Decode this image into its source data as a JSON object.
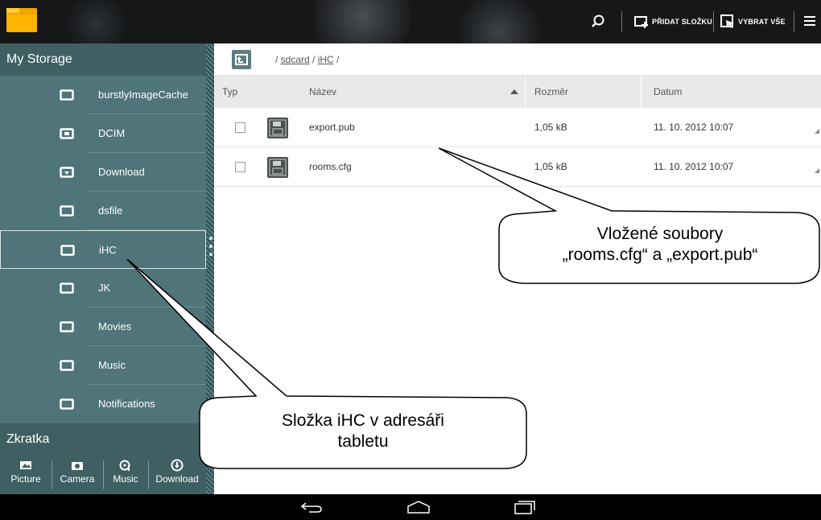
{
  "actionbar": {
    "search_icon": "search-icon",
    "add_folder_label": "PŘIDAT SLOŽKU",
    "select_all_label": "VYBRAT VŠE",
    "menu_icon": "overflow-menu-icon"
  },
  "sidebar": {
    "storage_header": "My Storage",
    "items": [
      {
        "label": "burstlyImageCache",
        "icon": "folder-icon"
      },
      {
        "label": "DCIM",
        "icon": "folder-image-icon"
      },
      {
        "label": "Download",
        "icon": "folder-download-icon"
      },
      {
        "label": "dsfile",
        "icon": "folder-icon"
      },
      {
        "label": "iHC",
        "icon": "folder-icon"
      },
      {
        "label": "JK",
        "icon": "folder-icon"
      },
      {
        "label": "Movies",
        "icon": "folder-icon"
      },
      {
        "label": "Music",
        "icon": "folder-icon"
      },
      {
        "label": "Notifications",
        "icon": "folder-icon"
      }
    ],
    "shortcut_header": "Zkratka",
    "shortcuts": [
      {
        "label": "Picture",
        "icon": "picture-icon"
      },
      {
        "label": "Camera",
        "icon": "camera-icon"
      },
      {
        "label": "Music",
        "icon": "music-icon"
      },
      {
        "label": "Download",
        "icon": "download-icon"
      }
    ]
  },
  "pathbar": {
    "prefix": "/ ",
    "seg1": "sdcard",
    "sep": " / ",
    "seg2": "iHC",
    "suffix": " /"
  },
  "table": {
    "headers": {
      "type": "Typ",
      "name": "Název",
      "size": "Rozměr",
      "date": "Datum"
    },
    "rows": [
      {
        "name": "export.pub",
        "size": "1,05 kB",
        "date": "11. 10. 2012 10:07"
      },
      {
        "name": "rooms.cfg",
        "size": "1,05 kB",
        "date": "11. 10. 2012 10:07"
      }
    ]
  },
  "callouts": {
    "files_line1": "Vložené soubory",
    "files_line2": "„rooms.cfg“ a „export.pub“",
    "folder_line1": "Složka iHC v  adresáři",
    "folder_line2": "tabletu"
  },
  "colors": {
    "sidebar": "#4f7479",
    "sidebar_header": "#3f5f63",
    "actionbar": "#161718",
    "table_header": "#e8eaea"
  }
}
